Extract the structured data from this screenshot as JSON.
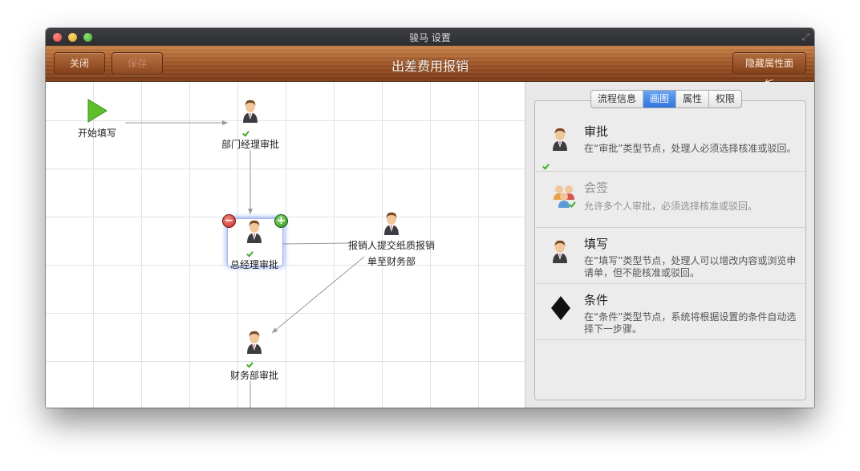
{
  "window": {
    "title": "骏马 设置"
  },
  "toolbar": {
    "close_label": "关闭",
    "save_label": "保存",
    "title": "出差费用报销",
    "hide_panel_label": "隐藏属性面板"
  },
  "workflow": {
    "nodes": [
      {
        "label": "开始填写",
        "type": "start"
      },
      {
        "label": "部门经理审批",
        "type": "approve"
      },
      {
        "label": "总经理审批",
        "type": "approve",
        "selected": true
      },
      {
        "label_line1": "报销人提交纸质报销",
        "label_line2": "单至财务部",
        "type": "fill"
      },
      {
        "label": "财务部审批",
        "type": "approve"
      }
    ]
  },
  "panel": {
    "tabs": [
      "流程信息",
      "画图",
      "属性",
      "权限"
    ],
    "active_tab": "画图",
    "items": [
      {
        "name": "审批",
        "desc": "在“审批”类型节点，处理人必须选择核准或驳回。",
        "icon": "person-approve-icon",
        "enabled": true
      },
      {
        "name": "会签",
        "desc": "允许多个人审批，必须选择核准或驳回。",
        "icon": "group-icon",
        "enabled": false
      },
      {
        "name": "填写",
        "desc": "在“填写”类型节点，处理人可以增改内容或浏览申请单，但不能核准或驳回。",
        "icon": "person-icon",
        "enabled": true
      },
      {
        "name": "条件",
        "desc": "在“条件”类型节点，系统将根据设置的条件自动选择下一步骤。",
        "icon": "diamond-icon",
        "enabled": true
      }
    ]
  },
  "colors": {
    "toolbar_wood": "#9e5427",
    "tab_active": "#2f73dd",
    "start_green": "#5fbf2a"
  }
}
